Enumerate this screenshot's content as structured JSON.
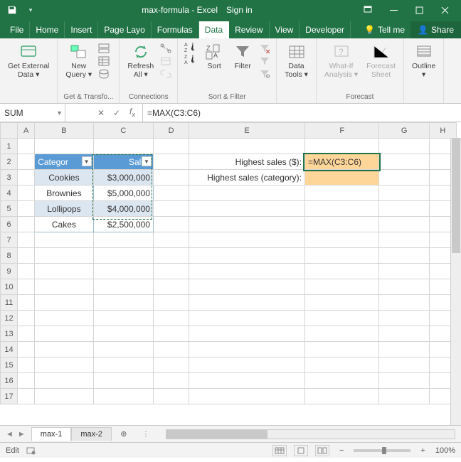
{
  "titlebar": {
    "doc_title": "max-formula - Excel",
    "signin": "Sign in"
  },
  "tabs": {
    "file": "File",
    "home": "Home",
    "insert": "Insert",
    "pagelayout": "Page Layo",
    "formulas": "Formulas",
    "data": "Data",
    "review": "Review",
    "view": "View",
    "developer": "Developer",
    "tellme": "Tell me",
    "share": "Share"
  },
  "ribbon": {
    "get_external_data": "Get External\nData ▾",
    "new_query": "New\nQuery ▾",
    "refresh_all": "Refresh\nAll ▾",
    "sort": "Sort",
    "filter": "Filter",
    "data_tools": "Data\nTools ▾",
    "whatif": "What-If\nAnalysis ▾",
    "forecast_sheet": "Forecast\nSheet",
    "outline": "Outline\n▾",
    "grp_get_transform": "Get & Transfo...",
    "grp_connections": "Connections",
    "grp_sort_filter": "Sort & Filter",
    "grp_forecast": "Forecast"
  },
  "formulabar": {
    "name": "SUM",
    "formula": "=MAX(C3:C6)"
  },
  "columns": [
    "A",
    "B",
    "C",
    "D",
    "E",
    "F",
    "G",
    "H"
  ],
  "rows": [
    "1",
    "2",
    "3",
    "4",
    "5",
    "6",
    "7",
    "8",
    "9",
    "10",
    "11",
    "12",
    "13",
    "14",
    "15",
    "16",
    "17"
  ],
  "table": {
    "header_category": "Categor",
    "header_sales": "Sales",
    "rows": [
      {
        "category": "Cookies",
        "sales": "$3,000,000"
      },
      {
        "category": "Brownies",
        "sales": "$5,000,000"
      },
      {
        "category": "Lollipops",
        "sales": "$4,000,000"
      },
      {
        "category": "Cakes",
        "sales": "$2,500,000"
      }
    ]
  },
  "labels": {
    "highest_sales_dollar": "Highest sales ($):",
    "highest_sales_category": "Highest sales (category):"
  },
  "editing": {
    "F2_display": "=MAX(C3:C6)"
  },
  "sheets": {
    "tab1": "max-1",
    "tab2": "max-2"
  },
  "statusbar": {
    "mode": "Edit",
    "zoom": "100%"
  }
}
